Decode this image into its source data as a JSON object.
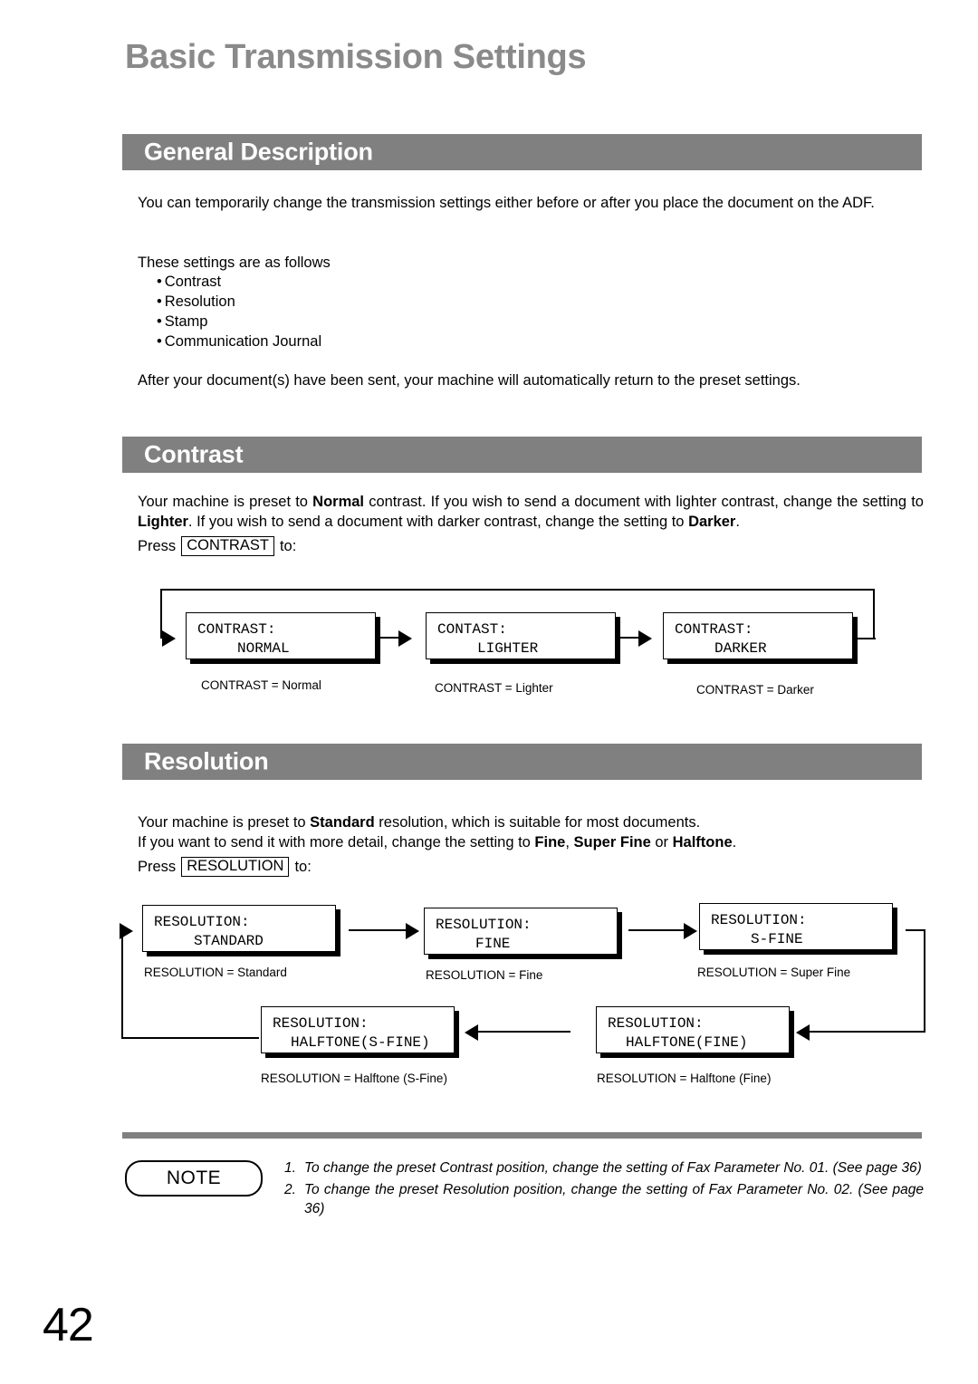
{
  "page": {
    "title": "Basic Transmission Settings",
    "number": "42"
  },
  "sections": {
    "general": {
      "heading": "General Description",
      "paragraph1": "You can temporarily change the transmission settings either before or after you place the document on the ADF.",
      "intro": "These settings are as follows",
      "bullets": [
        "Contrast",
        "Resolution",
        "Stamp",
        "Communication Journal"
      ],
      "paragraph2": "After your document(s) have been sent, your machine will automatically return to the preset settings."
    },
    "contrast": {
      "heading": "Contrast",
      "paragraph_pre_normal": "Your machine is preset to ",
      "bold_normal": "Normal",
      "paragraph_mid": " contrast.  If you wish to send a document with lighter contrast, change the setting to ",
      "bold_lighter": "Lighter",
      "paragraph_mid2": ".  If you wish to send a document with darker contrast, change the setting to ",
      "bold_darker": "Darker",
      "paragraph_end": ".",
      "press_prefix": "Press",
      "keycap": "CONTRAST",
      "press_suffix": "to:",
      "steps": [
        {
          "lcd_line1": "CONTRAST:",
          "lcd_line2": "NORMAL",
          "caption": "CONTRAST = Normal"
        },
        {
          "lcd_line1": "CONTAST:",
          "lcd_line2": "LIGHTER",
          "caption": "CONTRAST = Lighter"
        },
        {
          "lcd_line1": "CONTRAST:",
          "lcd_line2": "DARKER",
          "caption": "CONTRAST = Darker"
        }
      ]
    },
    "resolution": {
      "heading": "Resolution",
      "line1_pre": "Your machine is preset to ",
      "line1_bold": "Standard",
      "line1_post": " resolution, which is suitable for most documents.",
      "line2_pre": "If you want to send it with more detail, change the setting to ",
      "line2_bold1": "Fine",
      "line2_sep1": ", ",
      "line2_bold2": "Super Fine",
      "line2_sep2": " or ",
      "line2_bold3": "Halftone",
      "line2_post": ".",
      "press_prefix": "Press",
      "keycap": "RESOLUTION",
      "press_suffix": "to:",
      "steps": [
        {
          "lcd_line1": "RESOLUTION:",
          "lcd_line2": "STANDARD",
          "caption": "RESOLUTION = Standard"
        },
        {
          "lcd_line1": "RESOLUTION:",
          "lcd_line2": "FINE",
          "caption": "RESOLUTION = Fine"
        },
        {
          "lcd_line1": "RESOLUTION:",
          "lcd_line2": "S-FINE",
          "caption": "RESOLUTION = Super Fine"
        },
        {
          "lcd_line1": "RESOLUTION:",
          "lcd_line2": "HALFTONE(FINE)",
          "caption": "RESOLUTION = Halftone (Fine)"
        },
        {
          "lcd_line1": "RESOLUTION:",
          "lcd_line2": "HALFTONE(S-FINE)",
          "caption": "RESOLUTION = Halftone (S-Fine)"
        }
      ]
    }
  },
  "note": {
    "label": "NOTE",
    "items": [
      {
        "num": "1.",
        "text": "To change the preset Contrast position, change the setting of Fax Parameter No. 01. (See page 36)"
      },
      {
        "num": "2.",
        "text": "To change the preset Resolution position, change the setting of Fax Parameter No. 02.  (See page 36)"
      }
    ]
  },
  "colors": {
    "heading_bar": "#808080",
    "page_title": "#8a8a8a",
    "text": "#000000"
  }
}
